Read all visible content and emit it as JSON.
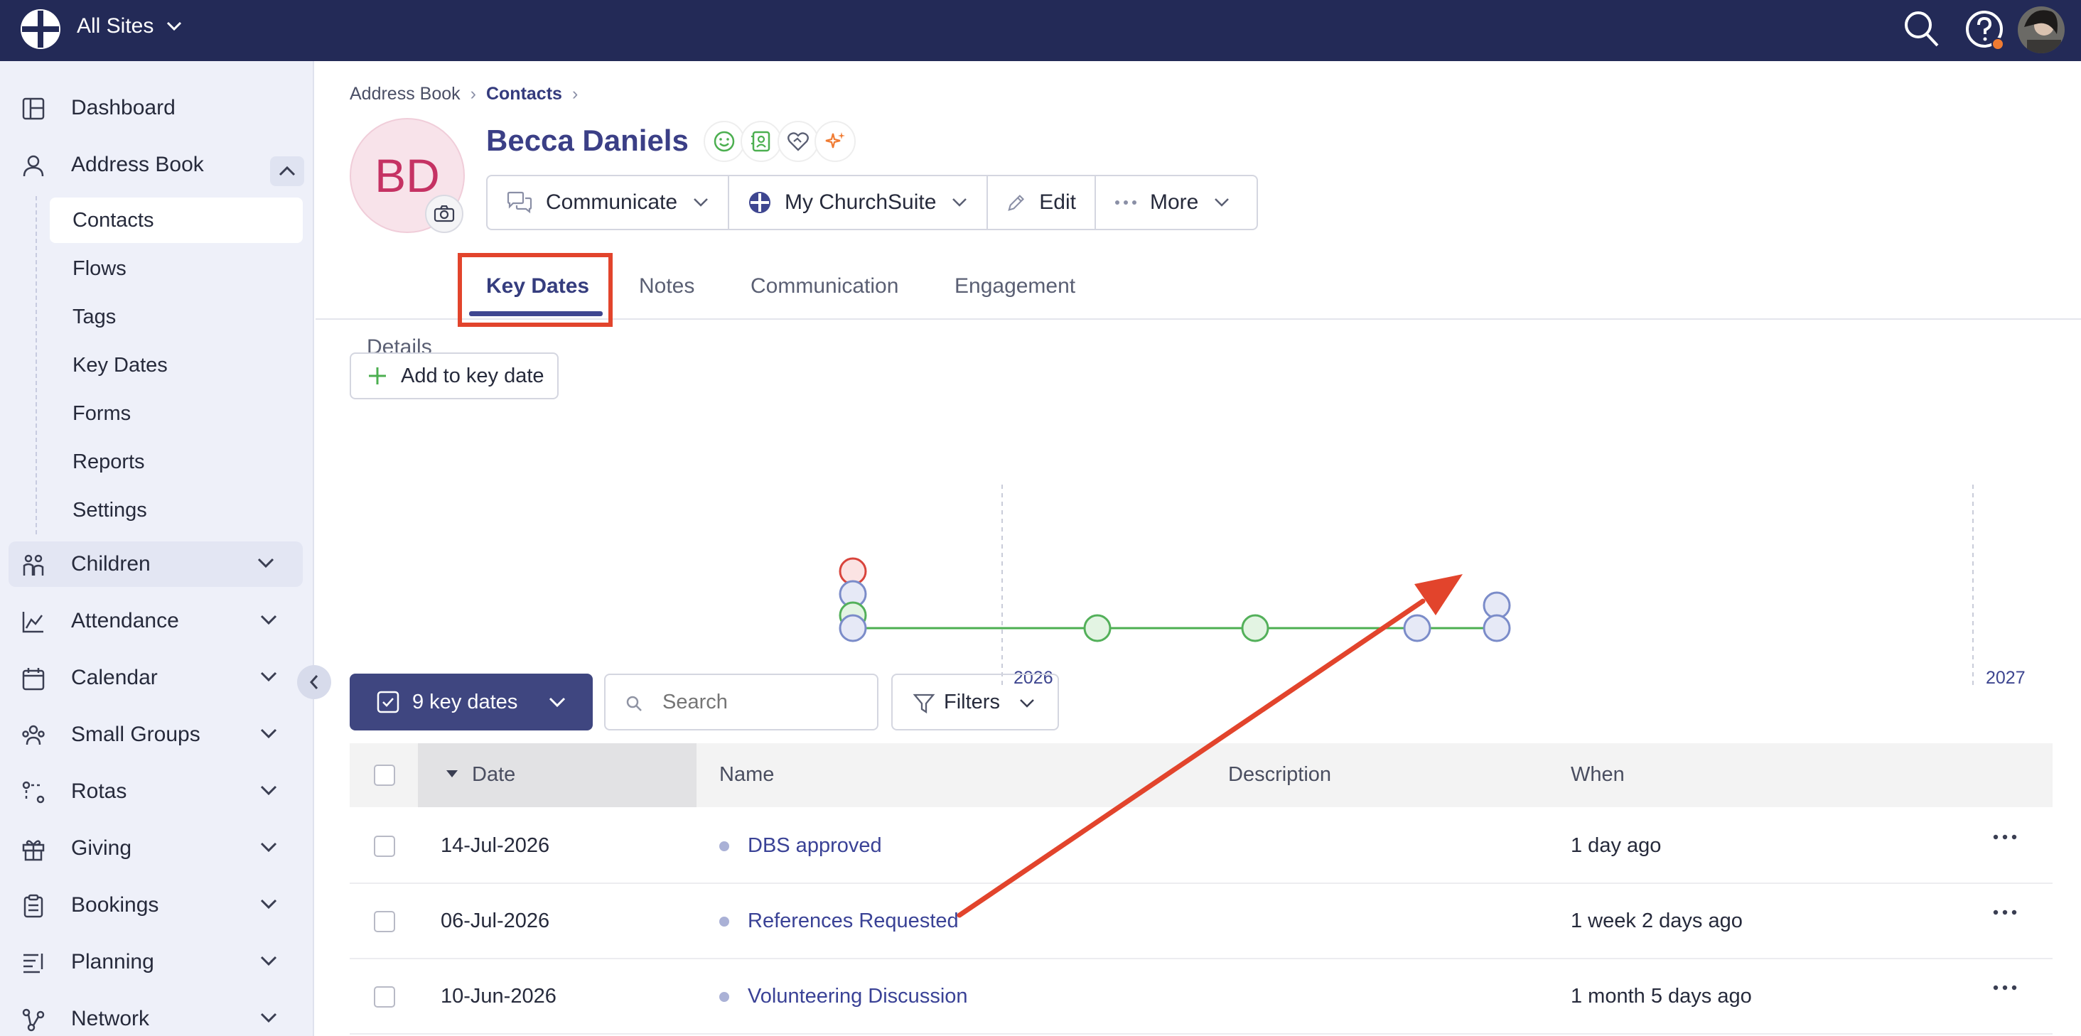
{
  "topbar": {
    "site_switch_label": "All Sites",
    "icons": [
      "churchsuite-logo-icon",
      "search-icon",
      "help-icon",
      "user-avatar"
    ]
  },
  "sidebar": {
    "items": [
      {
        "label": "Dashboard",
        "icon": "dashboard-icon"
      },
      {
        "label": "Address Book",
        "icon": "person-icon",
        "expanded": true
      },
      {
        "label": "Children",
        "icon": "children-icon"
      },
      {
        "label": "Attendance",
        "icon": "chart-icon"
      },
      {
        "label": "Calendar",
        "icon": "calendar-icon"
      },
      {
        "label": "Small Groups",
        "icon": "groups-icon"
      },
      {
        "label": "Rotas",
        "icon": "rotas-icon"
      },
      {
        "label": "Giving",
        "icon": "gift-icon"
      },
      {
        "label": "Bookings",
        "icon": "clipboard-icon"
      },
      {
        "label": "Planning",
        "icon": "planning-icon"
      },
      {
        "label": "Network",
        "icon": "network-icon"
      }
    ],
    "subitems": [
      "Contacts",
      "Flows",
      "Tags",
      "Key Dates",
      "Forms",
      "Reports",
      "Settings"
    ],
    "active_subitem": "Contacts"
  },
  "breadcrumb": {
    "parent": "Address Book",
    "current": "Contacts"
  },
  "contact": {
    "initials": "BD",
    "name": "Becca Daniels",
    "status_icons": [
      "smile-icon",
      "contact-card-icon",
      "handshake-heart-icon",
      "sparkle-icon"
    ]
  },
  "actions": {
    "communicate": "Communicate",
    "my_churchsuite": "My ChurchSuite",
    "edit": "Edit",
    "more": "More"
  },
  "tabs": [
    "Details",
    "Key Dates",
    "Notes",
    "Communication",
    "Engagement"
  ],
  "active_tab": "Key Dates",
  "add_key_date_label": "Add to key date",
  "timeline": {
    "year_labels": [
      "2026",
      "2027"
    ],
    "colors": {
      "line": "#4caf50",
      "blue": "#7b8cc9",
      "green": "#53b05a",
      "red": "#d9443c"
    }
  },
  "list_toolbar": {
    "selector_label": "9 key dates",
    "search_placeholder": "Search",
    "filters_label": "Filters"
  },
  "table": {
    "columns": [
      "Date",
      "Name",
      "Description",
      "When"
    ],
    "rows": [
      {
        "date": "14-Jul-2026",
        "name": "DBS approved",
        "description": "",
        "when": "1 day ago"
      },
      {
        "date": "06-Jul-2026",
        "name": "References Requested",
        "description": "",
        "when": "1 week 2 days ago"
      },
      {
        "date": "10-Jun-2026",
        "name": "Volunteering Discussion",
        "description": "",
        "when": "1 month 5 days ago"
      }
    ]
  },
  "annotation_color": "#e2442c"
}
